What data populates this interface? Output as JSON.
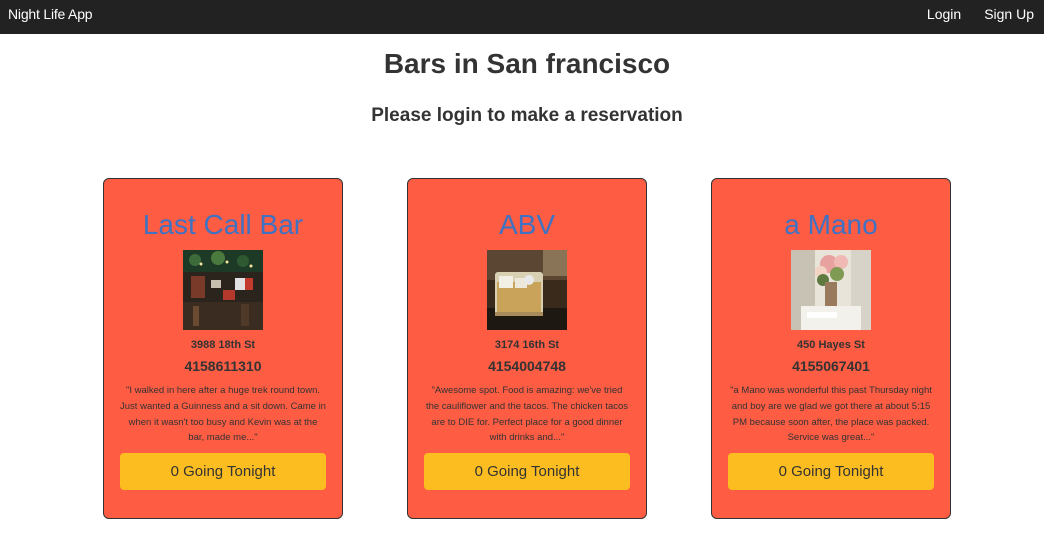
{
  "navbar": {
    "brand": "Night Life App",
    "login_label": "Login",
    "signup_label": "Sign Up"
  },
  "page": {
    "title": "Bars in San francisco",
    "subtitle": "Please login to make a reservation"
  },
  "bars": [
    {
      "name": "Last Call Bar",
      "address": "3988 18th St",
      "phone": "4158611310",
      "review": "\"I walked in here after a huge trek round town. Just wanted a Guinness and a sit down. Came in when it wasn't too busy and Kevin was at the bar, made me...\"",
      "going_label": "0 Going Tonight"
    },
    {
      "name": "ABV",
      "address": "3174 16th St",
      "phone": "4154004748",
      "review": "\"Awesome spot. Food is amazing: we've tried the cauliflower and the tacos. The chicken tacos are to DIE for. Perfect place for a good dinner with drinks and...\"",
      "going_label": "0 Going Tonight"
    },
    {
      "name": "a Mano",
      "address": "450 Hayes St",
      "phone": "4155067401",
      "review": "\"a Mano was wonderful this past Thursday night and boy are we glad we got there at about 5:15 PM because soon after, the place was packed. Service was great...\"",
      "going_label": "0 Going Tonight"
    }
  ],
  "colors": {
    "navbar_bg": "#222222",
    "card_bg": "#fe5c43",
    "bar_name": "#3f72c2",
    "button_bg": "#fcbd21"
  }
}
